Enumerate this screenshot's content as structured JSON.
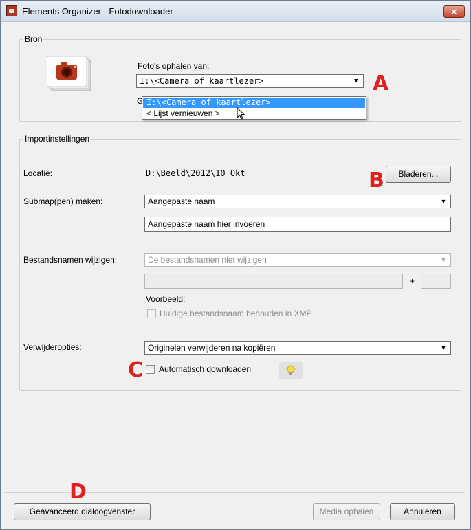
{
  "window": {
    "title": "Elements Organizer - Fotodownloader",
    "close_glyph": "✕"
  },
  "bron": {
    "legend": "Bron",
    "source_label": "Foto's ophalen van:",
    "source_value": "I:\\<Camera of kaartlezer>",
    "hidden_prefix": "G",
    "dropdown_items": [
      "I:\\<Camera of kaartlezer>",
      "< Lijst vernieuwen >"
    ]
  },
  "import": {
    "legend": "Importinstellingen",
    "location_label": "Locatie:",
    "location_value": "D:\\Beeld\\2012\\10 Okt",
    "browse_button": "Bladeren...",
    "subfolder_label": "Submap(pen) maken:",
    "subfolder_value": "Aangepaste naam",
    "custom_name_value": "Aangepaste naam hier invoeren",
    "rename_label": "Bestandsnamen wijzigen:",
    "rename_value": "De bestandsnamen niet wijzigen",
    "plus_sign": "+",
    "example_label": "Voorbeeld:",
    "keep_xmp_label": "Huidige bestandsnaam behouden in XMP",
    "delete_label": "Verwijderopties:",
    "delete_value": "Originelen verwijderen na kopiëren",
    "auto_download_label": "Automatisch downloaden"
  },
  "footer": {
    "advanced_button": "Geavanceerd dialoogvenster",
    "get_media_button": "Media ophalen",
    "cancel_button": "Annuleren"
  },
  "annotations": [
    "A",
    "B",
    "C",
    "D"
  ],
  "icons": {
    "camera": "camera-icon",
    "lightbulb": "lightbulb-icon",
    "dropdown_arrow": "▼",
    "cursor": "mouse-cursor-icon"
  },
  "colors": {
    "annotation": "#e0201c",
    "selection": "#3399ff",
    "close_button": "#c2472c"
  }
}
